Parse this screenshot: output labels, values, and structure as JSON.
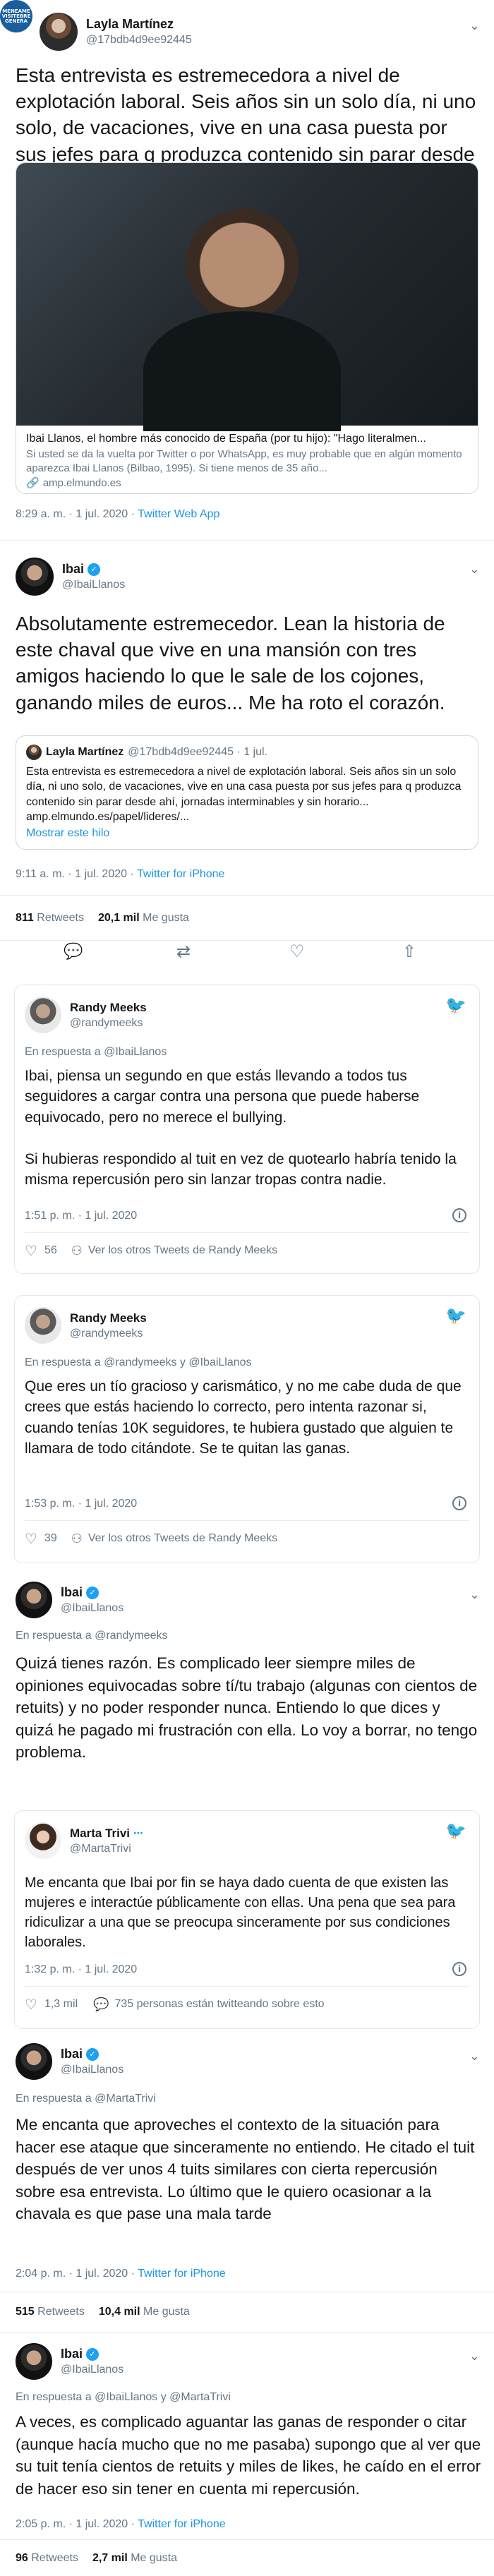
{
  "watermark": "MENEAME\nVISITEBRE\nGENERACION",
  "tweet1": {
    "name": "Layla Martínez",
    "handle": "@17bdb4d9ee92445",
    "text": "Esta entrevista es estremecedora a nivel de explotación laboral. Seis años sin un solo día, ni uno solo, de vacaciones, vive en una casa puesta por sus jefes para q produzca contenido sin parar desde ahí, jornadas interminables y sin horario...",
    "card_title": "Ibai Llanos, el hombre más conocido de España (por tu hijo): \"Hago literalmen...",
    "card_desc": "Si usted se da la vuelta por Twitter o por WhatsApp, es muy probable que en algún momento aparezca Ibai Llanos (Bilbao, 1995). Si tiene menos de 35 año...",
    "card_domain": "amp.elmundo.es",
    "time": "8:29 a. m. · 1 jul. 2020 · ",
    "app": "Twitter Web App"
  },
  "tweet2": {
    "name": "Ibai",
    "handle": "@IbaiLlanos",
    "text": "Absolutamente estremecedor. Lean la historia de este chaval que vive en una mansión con tres amigos haciendo lo que le sale de los cojones, ganando miles de euros... Me ha roto el corazón.",
    "quote_name": "Layla Martínez",
    "quote_handle": "@17bdb4d9ee92445 · 1 jul.",
    "quote_text": "Esta entrevista es estremecedora a nivel de explotación laboral. Seis años sin un solo día, ni uno solo, de vacaciones, vive en una casa puesta por sus jefes para q produzca contenido sin parar desde ahí, jornadas interminables y sin horario... amp.elmundo.es/papel/lideres/...",
    "show_thread": "Mostrar este hilo",
    "time": "9:11 a. m. · 1 jul. 2020 · ",
    "app": "Twitter for iPhone",
    "retweets": "811",
    "retweets_label": "Retweets",
    "likes": "20,1 mil",
    "likes_label": "Me gusta"
  },
  "randy1": {
    "name": "Randy Meeks",
    "handle": "@randymeeks",
    "reply_to": "En respuesta a @IbaiLlanos",
    "text": "Ibai, piensa un segundo en que estás llevando a todos tus seguidores a cargar contra una persona que puede haberse equivocado, pero no merece el bullying.\n\nSi hubieras respondido al tuit en vez de quotearlo habría tenido la misma repercusión pero sin lanzar tropas contra nadie.",
    "time": "1:51 p. m. · 1 jul. 2020",
    "likes": "56",
    "more": "Ver los otros Tweets de Randy Meeks"
  },
  "randy2": {
    "name": "Randy Meeks",
    "handle": "@randymeeks",
    "reply_to": "En respuesta a @randymeeks y @IbaiLlanos",
    "text": "Que eres un tío gracioso y carismático, y no me cabe duda de que crees que estás haciendo lo correcto, pero intenta razonar si, cuando tenías 10K seguidores, te hubiera gustado que alguien te llamara de todo citándote. Se te quitan las ganas.",
    "time": "1:53 p. m. · 1 jul. 2020",
    "likes": "39",
    "more": "Ver los otros Tweets de Randy Meeks"
  },
  "ibai2": {
    "name": "Ibai",
    "handle": "@IbaiLlanos",
    "reply_to": "En respuesta a @randymeeks",
    "text": "Quizá tienes razón. Es complicado leer siempre miles de opiniones equivocadas sobre tí/tu trabajo (algunas con cientos de retuits) y no poder responder nunca. Entiendo lo que dices y quizá he pagado mi frustración con ella. Lo voy a borrar, no tengo problema."
  },
  "marta": {
    "name": "Marta Trivi",
    "handle": "@MartaTrivi",
    "text": "Me encanta que Ibai por fin se haya dado cuenta de que existen las mujeres e interactúe públicamente con ellas. Una pena que sea para ridiculizar a una que se preocupa sinceramente por sus condiciones laborales.",
    "time": "1:32 p. m. · 1 jul. 2020",
    "likes": "1,3 mil",
    "talking": "735 personas están twitteando sobre esto"
  },
  "ibai3": {
    "name": "Ibai",
    "handle": "@IbaiLlanos",
    "reply_to": "En respuesta a @MartaTrivi",
    "text": "Me encanta que aproveches el contexto de la situación para hacer ese ataque que sinceramente no entiendo. He citado el tuit después de ver unos 4 tuits similares con cierta repercusión sobre esa entrevista. Lo último que le quiero ocasionar a la chavala es que pase una mala tarde",
    "time": "2:04 p. m. · 1 jul. 2020 · ",
    "app": "Twitter for iPhone",
    "retweets": "515",
    "retweets_label": "Retweets",
    "likes": "10,4 mil",
    "likes_label": "Me gusta"
  },
  "ibai4": {
    "name": "Ibai",
    "handle": "@IbaiLlanos",
    "reply_to": "En respuesta a @IbaiLlanos y @MartaTrivi",
    "text": "A veces, es complicado aguantar las ganas de responder o citar (aunque hacía mucho que no me pasaba) supongo que al ver que su tuit tenía cientos de retuits y miles de likes, he caído en el error de hacer eso sin tener en cuenta mi repercusión.",
    "time": "2:05 p. m. · 1 jul. 2020 · ",
    "app": "Twitter for iPhone",
    "retweets": "96",
    "retweets_label": "Retweets",
    "likes": "2,7 mil",
    "likes_label": "Me gusta"
  },
  "colors": {
    "link": "#1b95e0",
    "verified": "#1da1f2",
    "muted": "#657786"
  },
  "icons": [
    "chevron-down-icon",
    "verified-icon",
    "reply-icon",
    "retweet-icon",
    "like-icon",
    "share-icon",
    "twitter-bird-icon",
    "info-icon",
    "link-icon"
  ]
}
